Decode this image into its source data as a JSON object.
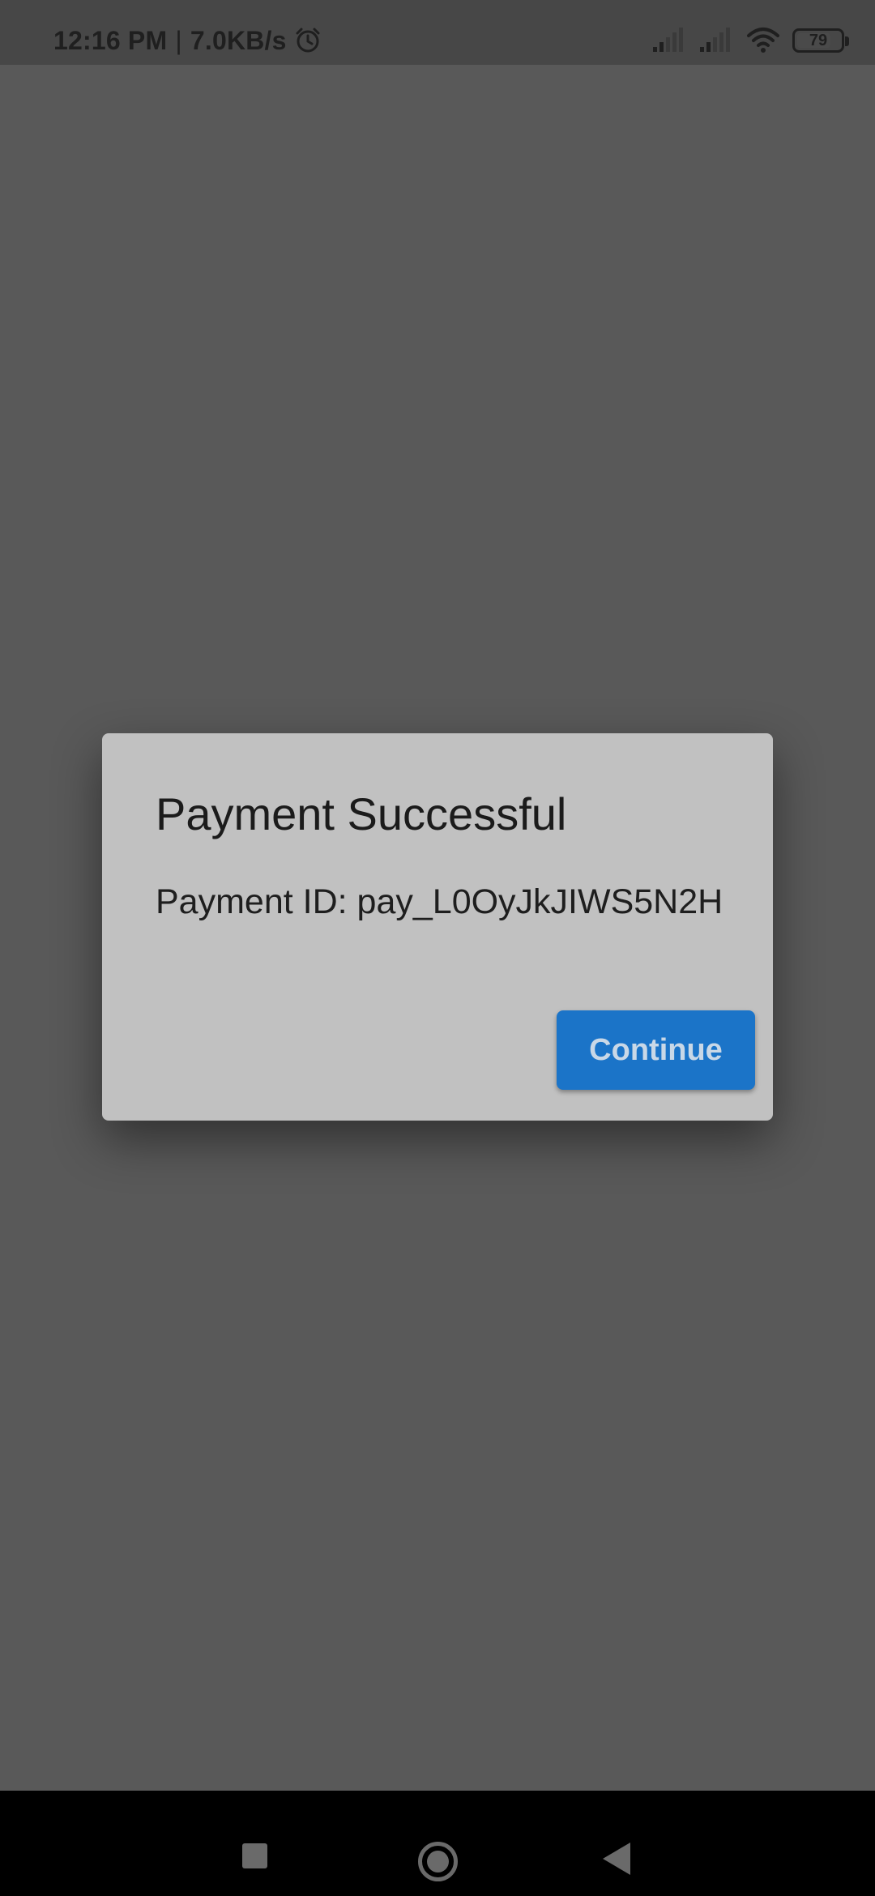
{
  "status_bar": {
    "time": "12:16 PM",
    "separator": "|",
    "network_speed": "7.0KB/s",
    "battery_level": "79",
    "icons": [
      "alarm-icon",
      "signal-icon",
      "signal-icon",
      "wifi-icon",
      "battery-icon"
    ]
  },
  "dialog": {
    "title": "Payment Successful",
    "message": "Payment ID: pay_L0OyJkJIWS5N2H",
    "continue_label": "Continue"
  },
  "nav_bar": {
    "icons": [
      "recents-icon",
      "home-icon",
      "back-icon"
    ]
  },
  "colors": {
    "scrim": "#595959",
    "dialog_background": "#c1c1c1",
    "button_primary": "#1b74c8"
  }
}
